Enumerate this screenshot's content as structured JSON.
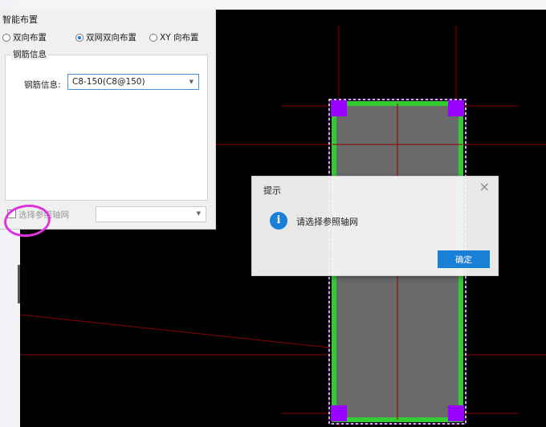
{
  "panel": {
    "title": "智能布置",
    "radio_options": [
      {
        "label": "双向布置",
        "selected": false
      },
      {
        "label": "双网双向布置",
        "selected": true
      },
      {
        "label": "XY 向布置",
        "selected": false
      }
    ],
    "group_title": "钢筋信息",
    "rebar_label": "钢筋信息:",
    "rebar_value": "C8-150(C8@150)",
    "ref_axis_label": "选择参照轴网",
    "ref_axis_checked": false,
    "ref_axis_value": ""
  },
  "dialog": {
    "title": "提示",
    "message": "请选择参照轴网",
    "ok_label": "确定",
    "icon": "info-icon",
    "close_icon": "close-icon"
  },
  "colors": {
    "canvas_bg": "#000000",
    "grid_line": "#8b0000",
    "rebar_green": "#33cc33",
    "slab_gray": "#6a6a6a",
    "corner_purple": "#9900ff",
    "highlight_ring": "#e033e0",
    "accent_blue": "#1a7fd6"
  }
}
